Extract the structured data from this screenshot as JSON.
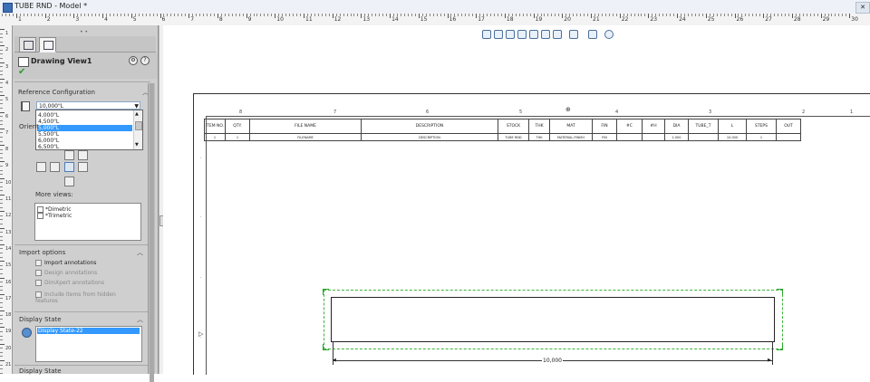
{
  "window": {
    "title": "TUBE RND - Model *"
  },
  "property_manager": {
    "title": "Drawing View1",
    "reference_configuration": {
      "label": "Reference Configuration",
      "selected": "10,000\"L",
      "options": [
        "4,000\"L",
        "4,500\"L",
        "5,000\"L",
        "5,500\"L",
        "6,000\"L",
        "6,500\"L"
      ],
      "highlighted_index": 2
    },
    "orientation": {
      "label": "Orient",
      "more_views_label": "More views:",
      "more_views": [
        "*Dimetric",
        "*Trimetric"
      ]
    },
    "import_options": {
      "label": "Import options",
      "import_annotations": "Import annotations",
      "design_annotations": "Design annotations",
      "dimxpert_annotations": "DimXpert annotations",
      "include_hidden": "Include items from hidden features"
    },
    "display_state": {
      "label": "Display State",
      "selected": "Display State-22",
      "next_group": "Display State"
    }
  },
  "ruler_labels": [
    "1",
    "2",
    "3",
    "4",
    "5",
    "6",
    "7",
    "8",
    "9",
    "10",
    "11",
    "12",
    "13",
    "14",
    "15",
    "16",
    "17",
    "18",
    "19",
    "20",
    "21",
    "22",
    "23",
    "24",
    "25",
    "26",
    "27",
    "28",
    "29",
    "30"
  ],
  "vruler_labels": [
    "1",
    "2",
    "3",
    "4",
    "5",
    "6",
    "7",
    "8",
    "9",
    "10",
    "11",
    "12",
    "13",
    "14",
    "15",
    "16",
    "17",
    "18",
    "19",
    "20",
    "21"
  ],
  "sheet_zones": [
    "8",
    "7",
    "6",
    "5",
    "4",
    "3",
    "2",
    "1"
  ],
  "bom": {
    "headers": [
      "ITEM NO.",
      "QTY.",
      "FILE NAME",
      "DESCRIPTION",
      "STOCK",
      "THK",
      "MAT",
      "FIN",
      "#C",
      "#H",
      "DIA",
      "TUBE_T",
      "L",
      "STEPS",
      "OUT"
    ],
    "row": [
      "1",
      "1",
      "FILENAME",
      "DESCRIPTION",
      "TUBE RND",
      "THK",
      "MATERIAL-FINISH",
      "FIN",
      "",
      "",
      "1.000",
      "",
      "10.000",
      "1",
      ""
    ]
  },
  "dimension": {
    "value": "10,000"
  }
}
